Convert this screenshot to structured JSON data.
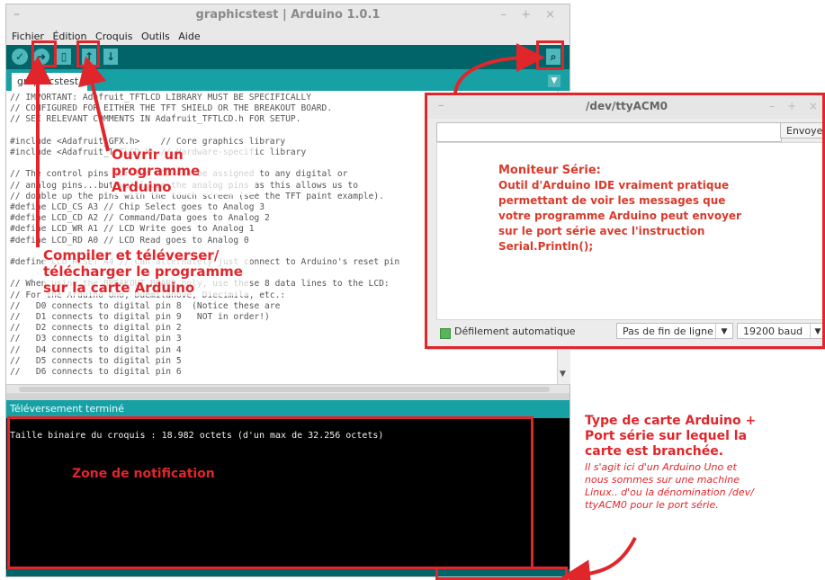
{
  "ide": {
    "window_title": "graphicstest | Arduino 1.0.1",
    "window_controls": "– + ×",
    "menu": [
      "Fichier",
      "Édition",
      "Croquis",
      "Outils",
      "Aide"
    ],
    "toolbar": {
      "verify_icon": "check-icon",
      "upload_icon": "arrow-right-icon",
      "new_icon": "new-file-icon",
      "open_icon": "arrow-up-icon",
      "save_icon": "arrow-down-icon",
      "serial_icon": "magnifier-icon"
    },
    "tab_label": "graphicstest",
    "code_lines": [
      "// IMPORTANT: Adafruit_TFTLCD LIBRARY MUST BE SPECIFICALLY",
      "// CONFIGURED FOR EITHER THE TFT SHIELD OR THE BREAKOUT BOARD.",
      "// SEE RELEVANT COMMENTS IN Adafruit_TFTLCD.h FOR SETUP.",
      "",
      "#include <Adafruit_GFX.h>    // Core graphics library",
      "#include <Adafruit_TFTLCD.h> // Hardware-specific library",
      "",
      "// The control pins for the LCD can be assigned to any digital or",
      "// analog pins...but we'll use the analog pins as this allows us to",
      "// double up the pins with the touch screen (see the TFT paint example).",
      "#define LCD_CS A3 // Chip Select goes to Analog 3",
      "#define LCD_CD A2 // Command/Data goes to Analog 2",
      "#define LCD_WR A1 // LCD Write goes to Analog 1",
      "#define LCD_RD A0 // LCD Read goes to Analog 0",
      "",
      "#define LCD_RESET A4 // Can alternately just connect to Arduino's reset pin",
      "",
      "// When using the BREAKOUT BOARD only, use these 8 data lines to the LCD:",
      "// For the Arduino Uno, Duemilanove, Diecimila, etc.:",
      "//   D0 connects to digital pin 8  (Notice these are",
      "//   D1 connects to digital pin 9   NOT in order!)",
      "//   D2 connects to digital pin 2",
      "//   D3 connects to digital pin 3",
      "//   D4 connects to digital pin 4",
      "//   D5 connects to digital pin 5",
      "//   D6 connects to digital pin 6"
    ],
    "status": "Téléversement terminé",
    "console_text": "Taille binaire du croquis : 18.982 octets (d'un max de 32.256 octets)"
  },
  "serial_monitor": {
    "title": "/dev/ttyACM0",
    "window_controls": "– + ×",
    "send_label": "Envoyer",
    "input_value": "",
    "autoscroll_label": "Défilement automatique",
    "line_ending": "Pas de fin de ligne",
    "baud": "19200 baud",
    "dropdown_icon": "▼"
  },
  "annotations": {
    "open_program": [
      "Ouvrir un",
      "programme Arduino"
    ],
    "compile_upload": [
      "Compiler et téléverser/",
      "télécharger le programme",
      "sur la carte Arduino"
    ],
    "serial_title": "Moniteur Série:",
    "serial_desc": [
      "Outil d'Arduino IDE vraiment pratique",
      "permettant de voir les messages que",
      "votre programme Arduino peut envoyer",
      "sur le port série avec l'instruction",
      "Serial.Println();"
    ],
    "notification_zone": "Zone de notification",
    "board_title": [
      "Type de carte Arduino +",
      "Port série sur lequel la",
      "carte est branchée."
    ],
    "board_desc": [
      "Il s'agit ici d'un Arduino Uno et",
      "nous sommes sur une machine",
      "Linux.. d'ou la dénomination /dev/",
      "ttyACM0 pour le port série."
    ]
  },
  "colors": {
    "accent_red": "#e1262b",
    "toolbar_teal": "#006468",
    "tab_teal": "#17a1a5",
    "button_teal": "#4db7bb"
  }
}
